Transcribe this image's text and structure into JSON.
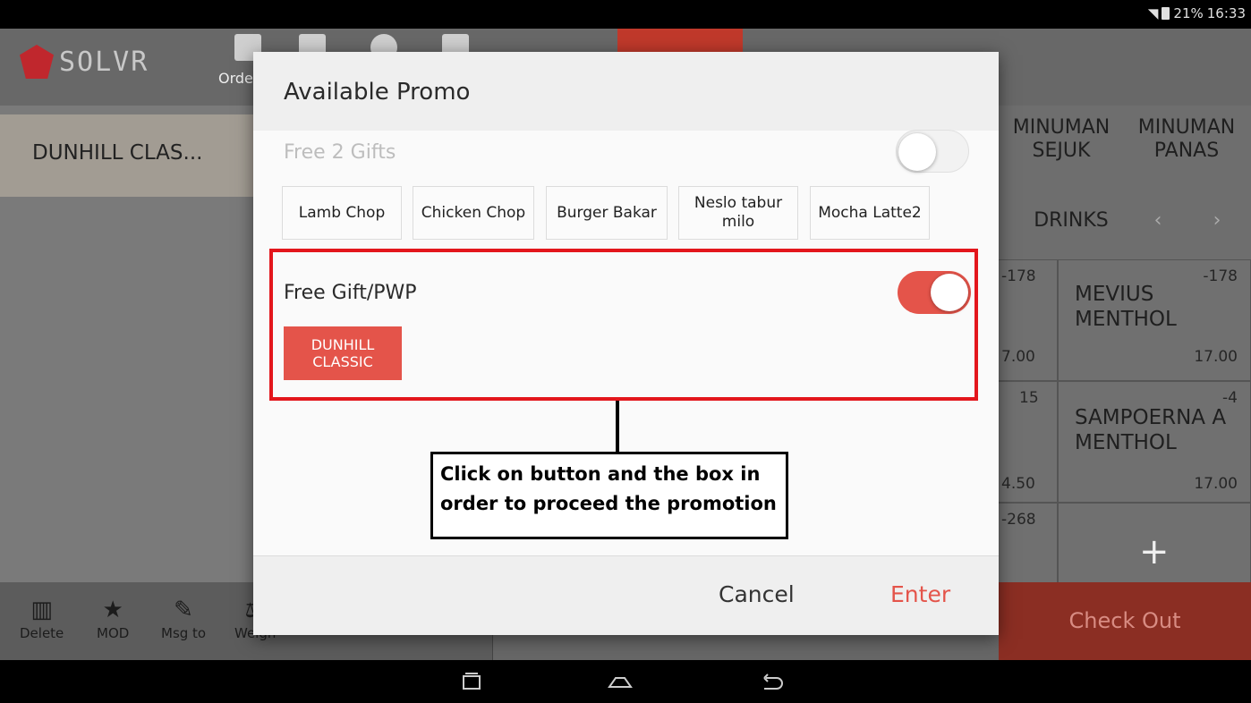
{
  "status_bar": {
    "battery": "21%",
    "time": "16:33"
  },
  "header": {
    "logo_text": "SOLVR",
    "order_label": "Orde"
  },
  "order": {
    "item": "DUNHILL CLAS..."
  },
  "tools": [
    {
      "label": "Delete",
      "icon": "trash-icon"
    },
    {
      "label": "MOD",
      "icon": "star-icon"
    },
    {
      "label": "Msg to",
      "icon": "pencil-icon"
    },
    {
      "label": "Weigh",
      "icon": "scale-icon"
    }
  ],
  "categories": {
    "cold_drinks": "MINUMAN SEJUK",
    "hot_drinks": "MINUMAN PANAS",
    "drinks": "DRINKS",
    "prev": "‹",
    "next": "›"
  },
  "products": {
    "partial_top_qty": "-178",
    "partial_top_price": "7.00",
    "mevius": {
      "name": "MEVIUS MENTHOL",
      "qty": "-178",
      "price": "17.00"
    },
    "partial_mid_qty": "15",
    "partial_mid_price": "4.50",
    "sampoerna": {
      "name": "SAMPOERNA A MENTHOL",
      "qty": "-4",
      "price": "17.00"
    },
    "partial_bot_qty": "-268",
    "add_symbol": "+"
  },
  "checkout_label": "Check Out",
  "dialog": {
    "title": "Available Promo",
    "promo1": {
      "label": "Free 2 Gifts",
      "enabled": false,
      "items": [
        "Lamb Chop",
        "Chicken Chop",
        "Burger Bakar",
        "Neslo tabur milo",
        "Mocha Latte2"
      ]
    },
    "promo2": {
      "label": "Free Gift/PWP",
      "enabled": true,
      "item": "DUNHILL CLASSIC"
    },
    "callout": "Click on button and the box in order to proceed the promotion",
    "cancel": "Cancel",
    "enter": "Enter"
  },
  "colors": {
    "accent": "#e4544a",
    "highlight": "#e3161c",
    "checkout": "#8b2e23"
  }
}
